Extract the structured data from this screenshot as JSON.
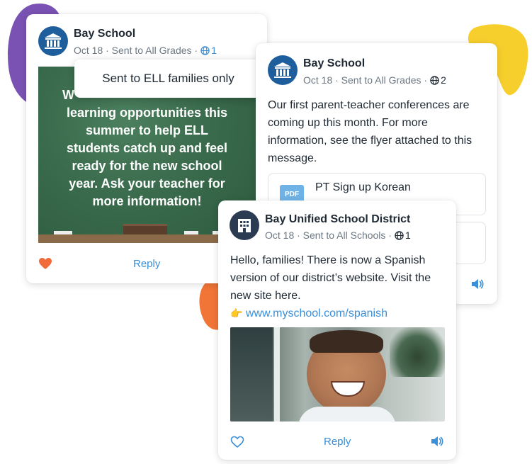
{
  "colors": {
    "purple_blob": "#7a52b3",
    "yellow_blob": "#f7cf2d",
    "orange_blob": "#f07537",
    "link_blue": "#3a8fd8",
    "heart_orange": "#f06a3a",
    "avatar_blue": "#1f5e9c",
    "avatar_dark": "#2a3b52"
  },
  "card_left": {
    "sender": "Bay School",
    "meta": "Oct 18 · Sent to All Grades ·",
    "globe_count": "1",
    "tooltip": "Sent to ELL families only",
    "image_lines": [
      "W",
      "learning opportunities this",
      "summer to help ELL",
      "students catch up and feel",
      "ready for the new school",
      "year. Ask your teacher for",
      "more information!"
    ],
    "reply_label": "Reply",
    "icons": {
      "avatar": "school-building-icon",
      "heart": "heart-filled-icon",
      "globe": "globe-icon"
    }
  },
  "card_right": {
    "sender": "Bay School",
    "meta": "Oct 18 · Sent to All Grades ·",
    "globe_count": "2",
    "message": "Our first parent-teacher conferences are coming up this month. For more information, see the flyer attached to this message.",
    "attachment_badge": "PDF",
    "attachment_name": "PT Sign up Korean",
    "icons": {
      "avatar": "school-building-icon",
      "speaker": "speaker-icon",
      "globe": "globe-icon"
    }
  },
  "card_front": {
    "sender": "Bay Unified School District",
    "meta": "Oct 18 · Sent to All Schools ·",
    "globe_count": "1",
    "message": "Hello, families! There is now a Spanish version of our district’s website. Visit the new site here.",
    "link_emoji": "👉",
    "link": "www.myschool.com/spanish",
    "reply_label": "Reply",
    "icons": {
      "avatar": "office-building-icon",
      "heart": "heart-outline-icon",
      "speaker": "speaker-icon",
      "globe": "globe-icon"
    }
  }
}
